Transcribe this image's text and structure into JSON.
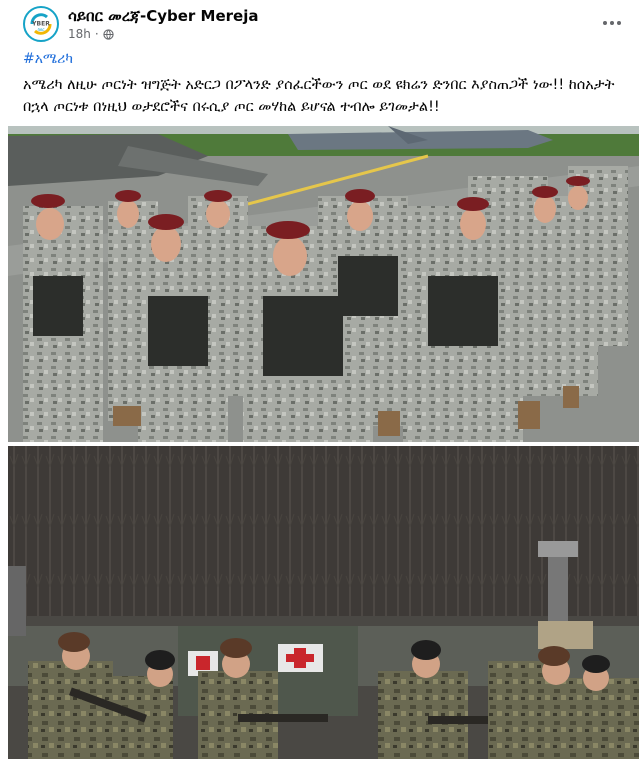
{
  "post": {
    "page_name": "ሳይበር መረጃ-Cyber Mereja",
    "time": "18h",
    "privacy_icon": "globe-icon",
    "more_icon": "more-options-icon",
    "hashtag": "#አሜሪካ",
    "text": "አሜሪካ ለዚሁ ጦርነት ዝግጅት አድርጋ በፖላንድ ያሰፈርችውን ጦር ወደ ዩክሬን ድንበር እያስጠጋች ነው!! ከሰአታት በኋላ ጦርነቱ በነዚህ ወታደሮችና በሩሲያ ጦር መሃከል ይሆናል ተብሎ ይገመታል!!",
    "avatar": {
      "logo_text": "YBER",
      "logo_subtext": "ሰበር"
    },
    "images": [
      {
        "name": "soldiers-marching-photo"
      },
      {
        "name": "soldiers-forest-photo"
      }
    ]
  },
  "colors": {
    "link": "#216fdb",
    "secondary_text": "#65676b",
    "brand": "#16a3c7"
  }
}
